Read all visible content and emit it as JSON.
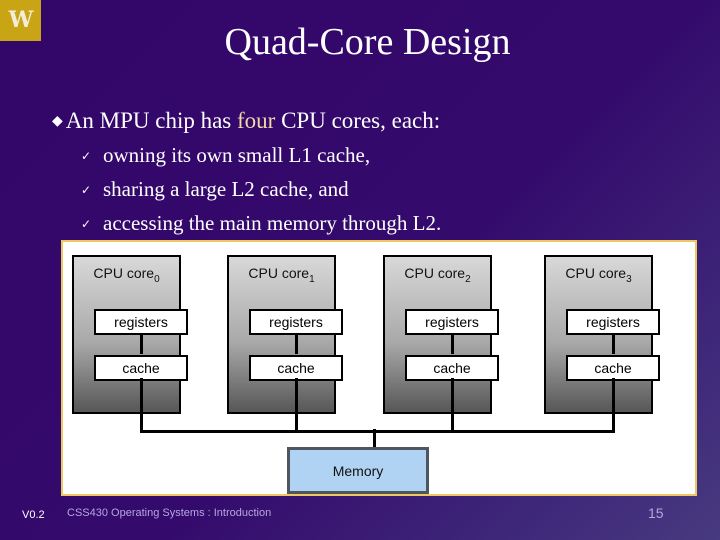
{
  "logo": {
    "letter": "W"
  },
  "title": "Quad-Core Design",
  "bullet": {
    "before": "An MPU chip has ",
    "highlight": "four",
    "after": " CPU cores, each:",
    "highlight_color": "#f2d7a7",
    "subitems": [
      "owning its own small L1 cache,",
      "sharing a large L2 cache, and",
      "accessing the main memory through L2."
    ]
  },
  "diagram": {
    "cores": [
      {
        "label": "CPU core",
        "index": "0",
        "registers": "registers",
        "cache": "cache"
      },
      {
        "label": "CPU core",
        "index": "1",
        "registers": "registers",
        "cache": "cache"
      },
      {
        "label": "CPU core",
        "index": "2",
        "registers": "registers",
        "cache": "cache"
      },
      {
        "label": "CPU core",
        "index": "3",
        "registers": "registers",
        "cache": "cache"
      }
    ],
    "memory_label": "Memory",
    "memory_color": "#b1d3f3"
  },
  "footer": {
    "version": "V0.2",
    "course": "CSS430 Operating Systems : Introduction",
    "page": "15"
  }
}
